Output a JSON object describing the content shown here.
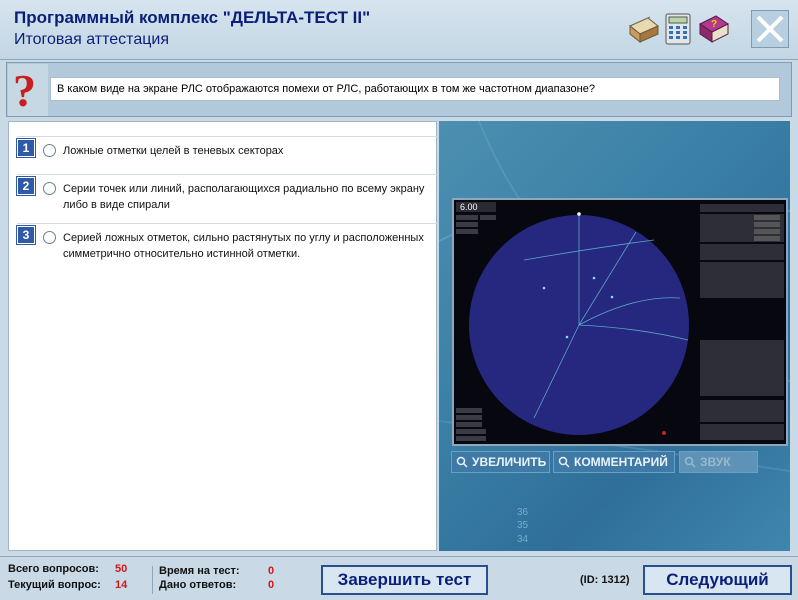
{
  "header": {
    "title": "Программный комплекс \"ДЕЛЬТА-ТЕСТ II\"",
    "subtitle": "Итоговая аттестация",
    "tools": [
      "notebook-icon",
      "calculator-icon",
      "help-book-icon"
    ]
  },
  "question": {
    "text": "В каком виде на экране РЛС отображаются помехи от РЛС, работающих в том же частотном диапазоне?"
  },
  "answers": [
    {
      "num": "1",
      "text": "Ложные отметки целей в теневых секторах"
    },
    {
      "num": "2",
      "text": "Серии точек или линий, располагающихся радиально по всему экрану либо в виде спирали"
    },
    {
      "num": "3",
      "text": "Серией ложных отметок, сильно растянутых по углу и расположенных симметрично относительно истинной отметки."
    }
  ],
  "image_panel": {
    "radar_range": "6.00",
    "buttons": {
      "zoom": "УВЕЛИЧИТЬ",
      "comment": "КОММЕНТАРИЙ",
      "sound": "ЗВУК"
    },
    "background_numbers": [
      "36",
      "35",
      "34"
    ]
  },
  "footer": {
    "total_label": "Всего вопросов:",
    "total_value": "50",
    "current_label": "Текущий вопрос:",
    "current_value": "14",
    "time_label": "Время на тест:",
    "time_value": "0",
    "answered_label": "Дано ответов:",
    "answered_value": "0",
    "finish_label": "Завершить тест",
    "id_text": "(ID: 1312)",
    "next_label": "Следующий"
  },
  "colors": {
    "accent": "#0a1f7a",
    "number_badge": "#2f5aa8",
    "counter": "#d01818",
    "radar_disc": "#2b2f8c"
  }
}
